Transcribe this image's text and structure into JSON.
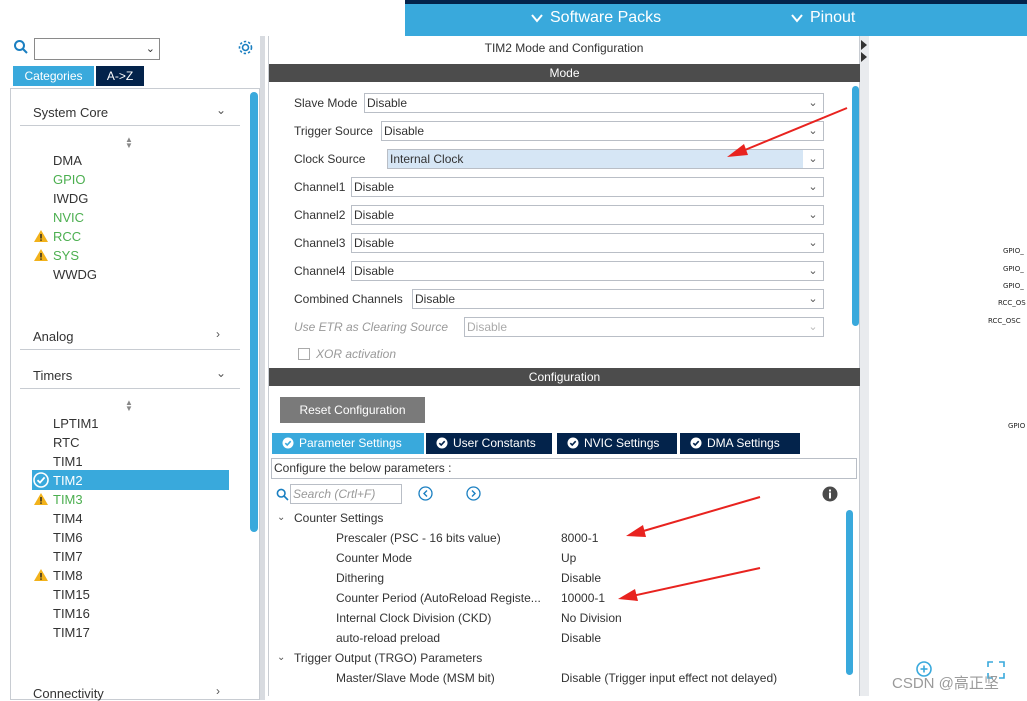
{
  "topbar": {
    "software_packs": "Software Packs",
    "pinout": "Pinout"
  },
  "left": {
    "tabs": {
      "categories": "Categories",
      "az": "A->Z"
    },
    "groups": {
      "system_core": "System Core",
      "analog": "Analog",
      "timers": "Timers",
      "connectivity": "Connectivity"
    },
    "system_core_items": [
      "DMA",
      "GPIO",
      "IWDG",
      "NVIC",
      "RCC",
      "SYS",
      "WWDG"
    ],
    "timer_items": [
      "LPTIM1",
      "RTC",
      "TIM1",
      "TIM2",
      "TIM3",
      "TIM4",
      "TIM6",
      "TIM7",
      "TIM8",
      "TIM15",
      "TIM16",
      "TIM17"
    ]
  },
  "mid": {
    "title": "TIM2 Mode and Configuration",
    "mode_bar": "Mode",
    "mode_rows": [
      {
        "label": "Slave Mode",
        "value": "Disable"
      },
      {
        "label": "Trigger Source",
        "value": "Disable"
      },
      {
        "label": "Clock Source",
        "value": "Internal Clock"
      },
      {
        "label": "Channel1",
        "value": "Disable"
      },
      {
        "label": "Channel2",
        "value": "Disable"
      },
      {
        "label": "Channel3",
        "value": "Disable"
      },
      {
        "label": "Channel4",
        "value": "Disable"
      },
      {
        "label": "Combined Channels",
        "value": "Disable"
      },
      {
        "label": "Use ETR as Clearing Source",
        "value": "Disable"
      }
    ],
    "xor_label": "XOR activation",
    "config_bar": "Configuration",
    "reset_button": "Reset Configuration",
    "tabs": [
      "Parameter Settings",
      "User Constants",
      "NVIC Settings",
      "DMA Settings"
    ],
    "configure_text": "Configure the below parameters :",
    "search_placeholder": "Search (Crtl+F)",
    "counter_settings": "Counter Settings",
    "params": [
      {
        "name": "Prescaler (PSC - 16 bits value)",
        "value": "8000-1"
      },
      {
        "name": "Counter Mode",
        "value": "Up"
      },
      {
        "name": "Dithering",
        "value": "Disable"
      },
      {
        "name": "Counter Period (AutoReload Registe...",
        "value": "10000-1"
      },
      {
        "name": "Internal Clock Division (CKD)",
        "value": "No Division"
      },
      {
        "name": "auto-reload preload",
        "value": "Disable"
      }
    ],
    "trgo": "Trigger Output (TRGO) Parameters",
    "msm": {
      "name": "Master/Slave Mode (MSM bit)",
      "value": "Disable (Trigger input effect not delayed)"
    }
  },
  "right": {
    "pins": [
      "GPIO_",
      "GPIO_",
      "GPIO_",
      "RCC_OS",
      "RCC_OSC",
      "GPIO"
    ]
  },
  "watermark": "CSDN @高正坚",
  "colors": {
    "accent": "#39a9dc",
    "dark": "#03234b",
    "arrow": "#e8231f"
  }
}
